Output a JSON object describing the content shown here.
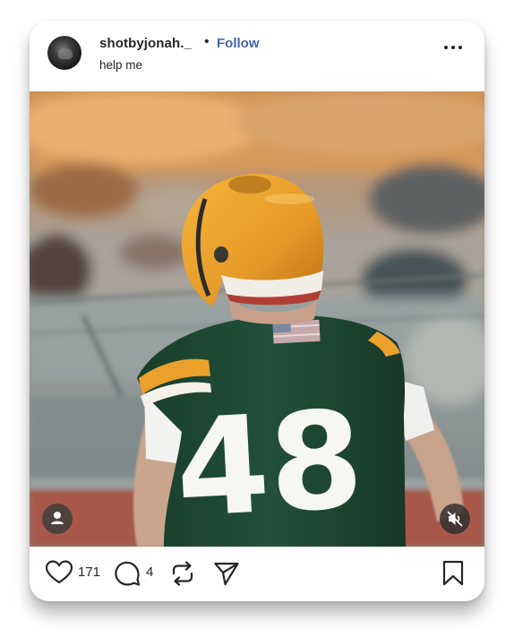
{
  "post": {
    "username": "shotbyjonah._",
    "separator": "•",
    "follow_label": "Follow",
    "caption": "help me"
  },
  "media": {
    "jersey_number": "48",
    "muted": true
  },
  "actions": {
    "likes_count": "171",
    "comments_count": "4"
  },
  "icons": {
    "avatar": "profile-avatar",
    "more": "more-options-icon",
    "tagged_user": "user-icon",
    "mute": "speaker-muted-icon",
    "like": "heart-icon",
    "comment": "comment-icon",
    "repost": "repost-icon",
    "share": "send-icon",
    "save": "bookmark-icon"
  },
  "colors": {
    "text": "#262626",
    "follow": "#4a64a8",
    "helmet": "#e9a12c",
    "jersey": "#1f4a35"
  }
}
